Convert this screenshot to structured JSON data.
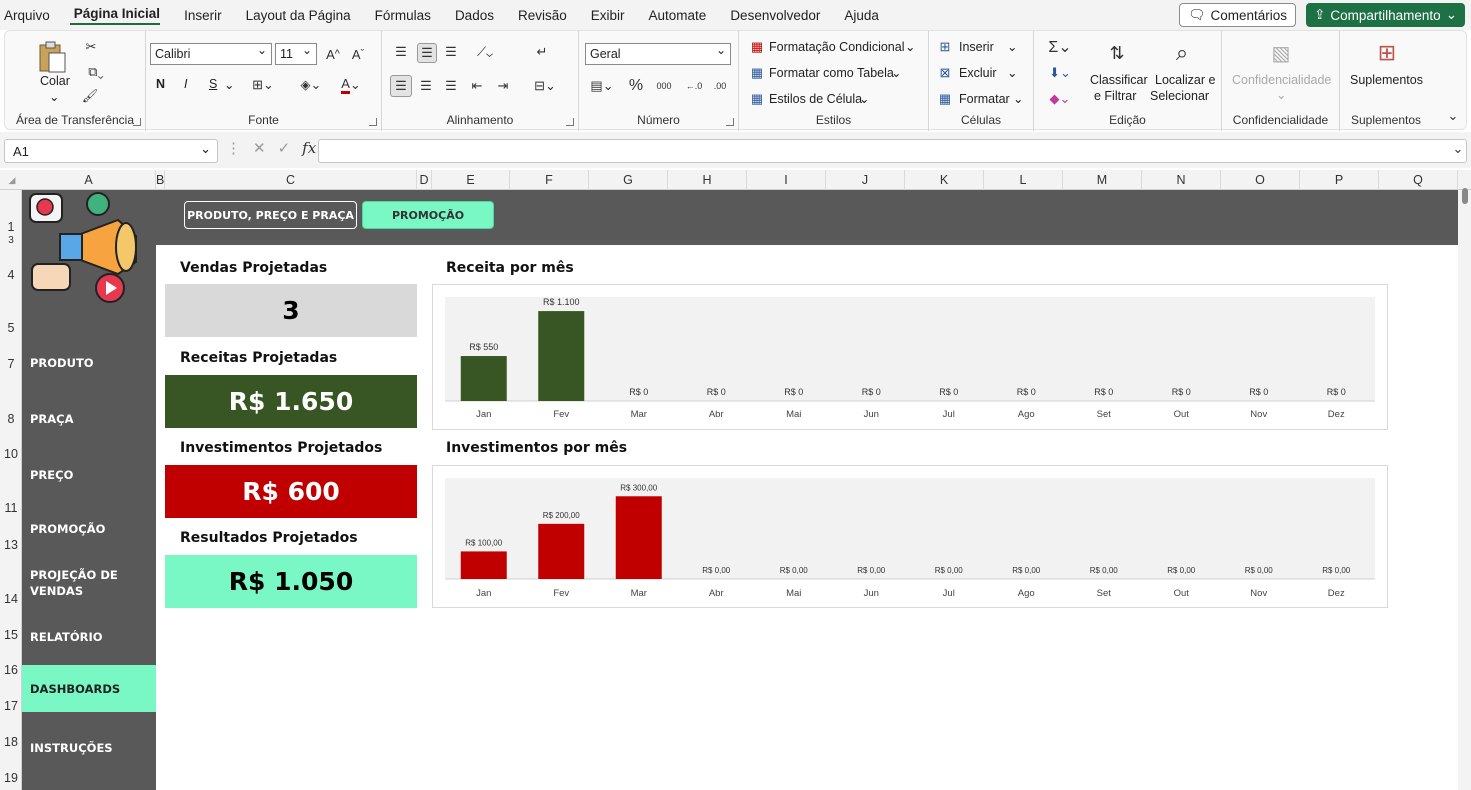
{
  "menu": {
    "tabs": [
      "Arquivo",
      "Página Inicial",
      "Inserir",
      "Layout da Página",
      "Fórmulas",
      "Dados",
      "Revisão",
      "Exibir",
      "Automate",
      "Desenvolvedor",
      "Ajuda"
    ],
    "active_tab": "Página Inicial",
    "comments_label": "Comentários",
    "share_label": "Compartilhamento"
  },
  "ribbon": {
    "clipboard": {
      "paste_label": "Colar",
      "group_label": "Área de Transferência"
    },
    "font": {
      "font_name": "Calibri",
      "font_size": "11",
      "group_label": "Fonte",
      "bold": "N",
      "italic": "I",
      "underline": "S"
    },
    "alignment": {
      "group_label": "Alinhamento"
    },
    "number": {
      "format": "Geral",
      "group_label": "Número"
    },
    "styles": {
      "conditional": "Formatação Condicional",
      "as_table": "Formatar como Tabela",
      "cell_styles": "Estilos de Célula",
      "group_label": "Estilos"
    },
    "cells": {
      "insert": "Inserir",
      "delete": "Excluir",
      "format": "Formatar",
      "group_label": "Células"
    },
    "editing": {
      "sort_line1": "Classificar",
      "sort_line2": "e Filtrar",
      "find_line1": "Localizar e",
      "find_line2": "Selecionar",
      "group_label": "Edição"
    },
    "sensitivity": {
      "label": "Confidencialidade",
      "group_label": "Confidencialidade"
    },
    "addins": {
      "label": "Suplementos",
      "group_label": "Suplementos"
    }
  },
  "formula_bar": {
    "cell_ref": "A1",
    "fx": "fx",
    "formula": ""
  },
  "columns": [
    "A",
    "B",
    "C",
    "D",
    "E",
    "F",
    "G",
    "H",
    "I",
    "J",
    "K",
    "L",
    "M",
    "N",
    "O",
    "P",
    "Q"
  ],
  "rows": [
    "1",
    "3",
    "4",
    "5",
    "7",
    "8",
    "10",
    "11",
    "13",
    "14",
    "15",
    "16",
    "17",
    "18",
    "19"
  ],
  "top_buttons": {
    "ppp": "PRODUTO, PREÇO E PRAÇA",
    "promo": "PROMOÇÃO"
  },
  "nav": {
    "items": [
      {
        "label": "PRODUTO",
        "active": false
      },
      {
        "label": "PRAÇA",
        "active": false
      },
      {
        "label": "PREÇO",
        "active": false
      },
      {
        "label": "PROMOÇÃO",
        "active": false
      },
      {
        "label": "PROJEÇÃO DE VENDAS",
        "active": false
      },
      {
        "label": "RELATÓRIO",
        "active": false
      },
      {
        "label": "DASHBOARDS",
        "active": true
      },
      {
        "label": "INSTRUÇÕES",
        "active": false
      }
    ]
  },
  "kpis": [
    {
      "title": "Vendas Projetadas",
      "value": "3",
      "bg": "#d9d9d9",
      "color": "#000000"
    },
    {
      "title": "Receitas Projetadas",
      "value": "R$ 1.650",
      "bg": "#375623",
      "color": "#ffffff"
    },
    {
      "title": "Investimentos Projetados",
      "value": "R$ 600",
      "bg": "#c00000",
      "color": "#ffffff"
    },
    {
      "title": "Resultados Projetados",
      "value": "R$ 1.050",
      "bg": "#79f7c4",
      "color": "#000000"
    }
  ],
  "colors": {
    "band": "#595959",
    "accent_green": "#79f7c4",
    "revenue_bar": "#375623",
    "invest_bar": "#c00000",
    "excel_green": "#1e7145"
  },
  "chart_data": [
    {
      "type": "bar",
      "title": "Receita por mês",
      "categories": [
        "Jan",
        "Fev",
        "Mar",
        "Abr",
        "Mai",
        "Jun",
        "Jul",
        "Ago",
        "Set",
        "Out",
        "Nov",
        "Dez"
      ],
      "values": [
        550,
        1100,
        0,
        0,
        0,
        0,
        0,
        0,
        0,
        0,
        0,
        0
      ],
      "data_labels": [
        "R$ 550",
        "R$ 1.100",
        "R$ 0",
        "R$ 0",
        "R$ 0",
        "R$ 0",
        "R$ 0",
        "R$ 0",
        "R$ 0",
        "R$ 0",
        "R$ 0",
        "R$ 0"
      ],
      "ylim": [
        0,
        1150
      ],
      "color": "#375623",
      "grid": false
    },
    {
      "type": "bar",
      "title": "Investimentos por mês",
      "categories": [
        "Jan",
        "Fev",
        "Mar",
        "Abr",
        "Mai",
        "Jun",
        "Jul",
        "Ago",
        "Set",
        "Out",
        "Nov",
        "Dez"
      ],
      "values": [
        100,
        200,
        300,
        0,
        0,
        0,
        0,
        0,
        0,
        0,
        0,
        0
      ],
      "data_labels": [
        "R$ 100,00",
        "R$ 200,00",
        "R$ 300,00",
        "R$ 0,00",
        "R$ 0,00",
        "R$ 0,00",
        "R$ 0,00",
        "R$ 0,00",
        "R$ 0,00",
        "R$ 0,00",
        "R$ 0,00",
        "R$ 0,00"
      ],
      "ylim": [
        0,
        330
      ],
      "color": "#c00000",
      "grid": false
    }
  ]
}
